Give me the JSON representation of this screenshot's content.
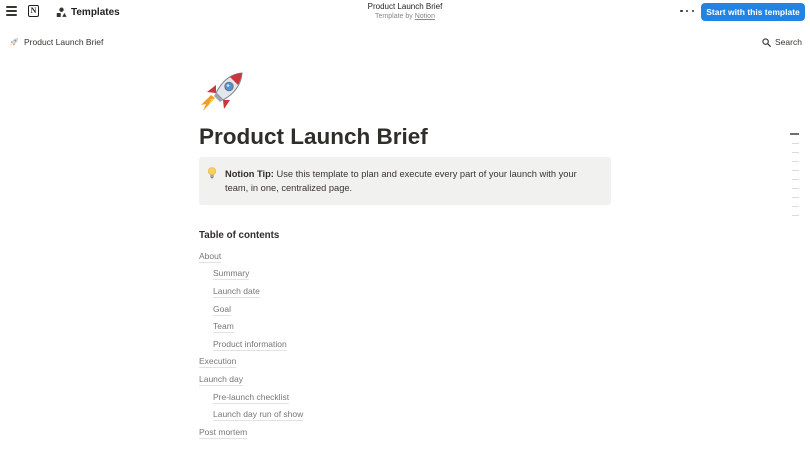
{
  "topbar": {
    "templates_label": "Templates",
    "page_title": "Product Launch Brief",
    "template_by_prefix": "Template by",
    "template_by_author": "Notion",
    "start_button": "Start with this template",
    "accent_color": "#2383e2"
  },
  "subbar": {
    "breadcrumb_icon": "rocket-emoji",
    "breadcrumb_label": "Product Launch Brief",
    "search_label": "Search"
  },
  "page": {
    "icon": "rocket-emoji",
    "title": "Product Launch Brief",
    "callout": {
      "icon": "lightbulb-emoji",
      "bold_text": "Notion Tip:",
      "text": " Use this template to plan and execute every part of your launch with your team, in one, centralized page."
    },
    "toc": {
      "heading": "Table of contents",
      "items": [
        {
          "label": "About"
        },
        {
          "label": "Summary"
        },
        {
          "label": "Launch date"
        },
        {
          "label": "Goal"
        },
        {
          "label": "Team"
        },
        {
          "label": "Product information"
        },
        {
          "label": "Execution"
        },
        {
          "label": "Launch day"
        },
        {
          "label": "Pre-launch checklist"
        },
        {
          "label": "Launch day run of show"
        },
        {
          "label": "Post mortem"
        }
      ]
    }
  }
}
